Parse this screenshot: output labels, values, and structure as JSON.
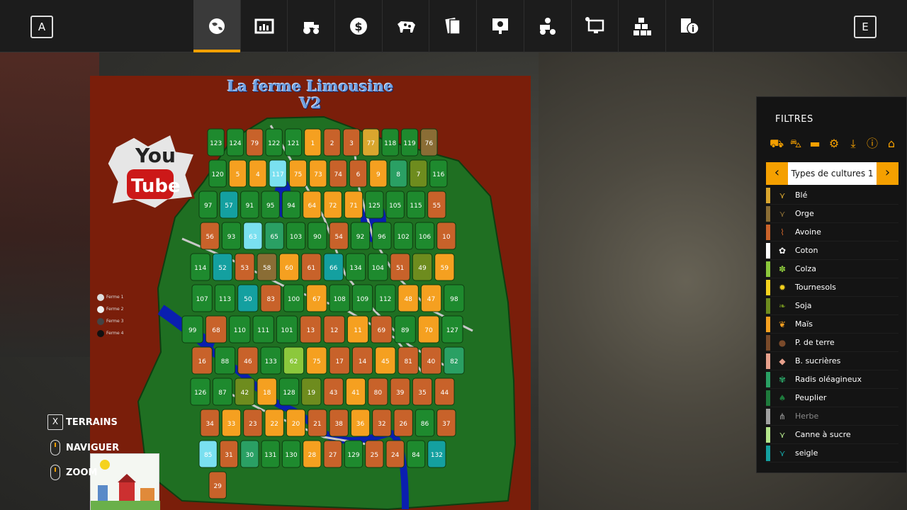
{
  "keys": {
    "left": "A",
    "right": "E"
  },
  "tabs": [
    {
      "name": "map-tab",
      "icon": "globe-icon",
      "active": true
    },
    {
      "name": "stats-tab",
      "icon": "chart-icon",
      "active": false
    },
    {
      "name": "vehicles-tab",
      "icon": "tractor-icon",
      "active": false
    },
    {
      "name": "finances-tab",
      "icon": "dollar-icon",
      "active": false
    },
    {
      "name": "animals-tab",
      "icon": "cow-icon",
      "active": false
    },
    {
      "name": "contracts-tab",
      "icon": "cards-icon",
      "active": false
    },
    {
      "name": "help-tab",
      "icon": "screen-help-icon",
      "active": false
    },
    {
      "name": "prices-tab",
      "icon": "tractor-gear-icon",
      "active": false
    },
    {
      "name": "settings-tab",
      "icon": "monitor-icon",
      "active": false
    },
    {
      "name": "production-tab",
      "icon": "blocks-icon",
      "active": false
    },
    {
      "name": "info-tab",
      "icon": "info-icon",
      "active": false
    }
  ],
  "map": {
    "title_line1": "La ferme Limousine",
    "title_line2": "V2",
    "logo_top": "You",
    "logo_bottom": "Tube",
    "legend": [
      {
        "label": "Ferme 1",
        "color": "#dddddd"
      },
      {
        "label": "Ferme 2",
        "color": "#f0f0f0"
      },
      {
        "label": "Ferme 3",
        "color": "#444444"
      },
      {
        "label": "Ferme 4",
        "color": "#111111"
      }
    ]
  },
  "controls": [
    {
      "key": "X",
      "label": "TERRAINS"
    },
    {
      "key": "mouse",
      "label": "NAVIGUER"
    },
    {
      "key": "mouse",
      "label": "ZOOM"
    }
  ],
  "panel": {
    "title": "FILTRES",
    "filter_icons": [
      "tractor-icon",
      "harvester-icon",
      "trailer-icon",
      "gears-icon",
      "download-icon",
      "warning-icon",
      "home-icon"
    ],
    "selector_label": "Types de cultures 1",
    "crops": [
      {
        "name": "Blé",
        "color": "#d9a62e",
        "icon": "wheat-icon",
        "dim": false
      },
      {
        "name": "Orge",
        "color": "#8a6d35",
        "icon": "barley-icon",
        "dim": false
      },
      {
        "name": "Avoine",
        "color": "#c9622a",
        "icon": "oat-icon",
        "dim": false
      },
      {
        "name": "Coton",
        "color": "#ffffff",
        "icon": "cotton-icon",
        "dim": false
      },
      {
        "name": "Colza",
        "color": "#8cc83c",
        "icon": "canola-icon",
        "dim": false
      },
      {
        "name": "Tournesols",
        "color": "#f5d21e",
        "icon": "sunflower-icon",
        "dim": false
      },
      {
        "name": "Soja",
        "color": "#6e8c1e",
        "icon": "soy-icon",
        "dim": false
      },
      {
        "name": "Maïs",
        "color": "#f5a020",
        "icon": "corn-icon",
        "dim": false
      },
      {
        "name": "P. de terre",
        "color": "#7a4a2a",
        "icon": "potato-icon",
        "dim": false
      },
      {
        "name": "B. sucrières",
        "color": "#e6a08c",
        "icon": "beet-icon",
        "dim": false
      },
      {
        "name": "Radis oléagineux",
        "color": "#2aa064",
        "icon": "radish-icon",
        "dim": false
      },
      {
        "name": "Peuplier",
        "color": "#1e7a3c",
        "icon": "poplar-icon",
        "dim": false
      },
      {
        "name": "Herbe",
        "color": "#a0a0a0",
        "icon": "grass-icon",
        "dim": true
      },
      {
        "name": "Canne à sucre",
        "color": "#b4e68c",
        "icon": "sugarcane-icon",
        "dim": false
      },
      {
        "name": "seigle",
        "color": "#14a0a0",
        "icon": "rye-icon",
        "dim": false
      }
    ]
  },
  "fields": [
    {
      "n": "123",
      "c": "#1e8a2e"
    },
    {
      "n": "124",
      "c": "#1e8a2e"
    },
    {
      "n": "79",
      "c": "#c8622a"
    },
    {
      "n": "122",
      "c": "#1e8a2e"
    },
    {
      "n": "121",
      "c": "#1e8a2e"
    },
    {
      "n": "1",
      "c": "#f5a020"
    },
    {
      "n": "2",
      "c": "#c8622a"
    },
    {
      "n": "3",
      "c": "#c8622a"
    },
    {
      "n": "77",
      "c": "#d9a62e"
    },
    {
      "n": "118",
      "c": "#1e8a2e"
    },
    {
      "n": "119",
      "c": "#1e8a2e"
    },
    {
      "n": "76",
      "c": "#8a6d35"
    },
    {
      "n": "120",
      "c": "#1e8a2e"
    },
    {
      "n": "5",
      "c": "#f5a020"
    },
    {
      "n": "4",
      "c": "#f5a020"
    },
    {
      "n": "117",
      "c": "#7ae0f0"
    },
    {
      "n": "75",
      "c": "#f5a020"
    },
    {
      "n": "73",
      "c": "#f5a020"
    },
    {
      "n": "74",
      "c": "#c8622a"
    },
    {
      "n": "6",
      "c": "#c8622a"
    },
    {
      "n": "9",
      "c": "#f5a020"
    },
    {
      "n": "8",
      "c": "#2aa064"
    },
    {
      "n": "7",
      "c": "#6e8c1e"
    },
    {
      "n": "116",
      "c": "#1e8a2e"
    },
    {
      "n": "97",
      "c": "#1e8a2e"
    },
    {
      "n": "57",
      "c": "#14a0a0"
    },
    {
      "n": "91",
      "c": "#1e8a2e"
    },
    {
      "n": "95",
      "c": "#1e8a2e"
    },
    {
      "n": "94",
      "c": "#1e8a2e"
    },
    {
      "n": "64",
      "c": "#f5a020"
    },
    {
      "n": "72",
      "c": "#f5a020"
    },
    {
      "n": "71",
      "c": "#f5a020"
    },
    {
      "n": "125",
      "c": "#1e8a2e"
    },
    {
      "n": "105",
      "c": "#1e8a2e"
    },
    {
      "n": "115",
      "c": "#1e8a2e"
    },
    {
      "n": "55",
      "c": "#c8622a"
    },
    {
      "n": "56",
      "c": "#c8622a"
    },
    {
      "n": "93",
      "c": "#1e8a2e"
    },
    {
      "n": "63",
      "c": "#7ae0f0"
    },
    {
      "n": "65",
      "c": "#2aa064"
    },
    {
      "n": "103",
      "c": "#1e8a2e"
    },
    {
      "n": "90",
      "c": "#1e8a2e"
    },
    {
      "n": "54",
      "c": "#c8622a"
    },
    {
      "n": "92",
      "c": "#1e8a2e"
    },
    {
      "n": "96",
      "c": "#1e8a2e"
    },
    {
      "n": "102",
      "c": "#1e8a2e"
    },
    {
      "n": "106",
      "c": "#1e8a2e"
    },
    {
      "n": "10",
      "c": "#c8622a"
    },
    {
      "n": "114",
      "c": "#1e8a2e"
    },
    {
      "n": "52",
      "c": "#14a0a0"
    },
    {
      "n": "53",
      "c": "#c8622a"
    },
    {
      "n": "58",
      "c": "#8a6d35"
    },
    {
      "n": "60",
      "c": "#f5a020"
    },
    {
      "n": "61",
      "c": "#c8622a"
    },
    {
      "n": "66",
      "c": "#14a0a0"
    },
    {
      "n": "134",
      "c": "#1e8a2e"
    },
    {
      "n": "104",
      "c": "#1e8a2e"
    },
    {
      "n": "51",
      "c": "#c8622a"
    },
    {
      "n": "49",
      "c": "#6e8c1e"
    },
    {
      "n": "59",
      "c": "#f5a020"
    },
    {
      "n": "107",
      "c": "#1e8a2e"
    },
    {
      "n": "113",
      "c": "#1e8a2e"
    },
    {
      "n": "50",
      "c": "#14a0a0"
    },
    {
      "n": "83",
      "c": "#c8622a"
    },
    {
      "n": "100",
      "c": "#1e8a2e"
    },
    {
      "n": "67",
      "c": "#f5a020"
    },
    {
      "n": "108",
      "c": "#1e8a2e"
    },
    {
      "n": "109",
      "c": "#1e8a2e"
    },
    {
      "n": "112",
      "c": "#1e8a2e"
    },
    {
      "n": "48",
      "c": "#f5a020"
    },
    {
      "n": "47",
      "c": "#f5a020"
    },
    {
      "n": "98",
      "c": "#1e8a2e"
    },
    {
      "n": "99",
      "c": "#1e8a2e"
    },
    {
      "n": "68",
      "c": "#c8622a"
    },
    {
      "n": "110",
      "c": "#1e8a2e"
    },
    {
      "n": "111",
      "c": "#1e8a2e"
    },
    {
      "n": "101",
      "c": "#1e8a2e"
    },
    {
      "n": "13",
      "c": "#c8622a"
    },
    {
      "n": "12",
      "c": "#c8622a"
    },
    {
      "n": "11",
      "c": "#f5a020"
    },
    {
      "n": "69",
      "c": "#c8622a"
    },
    {
      "n": "89",
      "c": "#1e8a2e"
    },
    {
      "n": "70",
      "c": "#f5a020"
    },
    {
      "n": "127",
      "c": "#1e8a2e"
    },
    {
      "n": "16",
      "c": "#c8622a"
    },
    {
      "n": "88",
      "c": "#1e8a2e"
    },
    {
      "n": "46",
      "c": "#c8622a"
    },
    {
      "n": "133",
      "c": "#1e8a2e"
    },
    {
      "n": "62",
      "c": "#8cc83c"
    },
    {
      "n": "75",
      "c": "#f5a020"
    },
    {
      "n": "17",
      "c": "#c8622a"
    },
    {
      "n": "14",
      "c": "#c8622a"
    },
    {
      "n": "45",
      "c": "#f5a020"
    },
    {
      "n": "81",
      "c": "#c8622a"
    },
    {
      "n": "40",
      "c": "#c8622a"
    },
    {
      "n": "82",
      "c": "#2aa064"
    },
    {
      "n": "126",
      "c": "#1e8a2e"
    },
    {
      "n": "87",
      "c": "#1e8a2e"
    },
    {
      "n": "42",
      "c": "#6e8c1e"
    },
    {
      "n": "18",
      "c": "#f5a020"
    },
    {
      "n": "128",
      "c": "#1e8a2e"
    },
    {
      "n": "19",
      "c": "#6e8c1e"
    },
    {
      "n": "43",
      "c": "#c8622a"
    },
    {
      "n": "41",
      "c": "#f5a020"
    },
    {
      "n": "80",
      "c": "#c8622a"
    },
    {
      "n": "39",
      "c": "#c8622a"
    },
    {
      "n": "35",
      "c": "#c8622a"
    },
    {
      "n": "44",
      "c": "#c8622a"
    },
    {
      "n": "34",
      "c": "#c8622a"
    },
    {
      "n": "33",
      "c": "#f5a020"
    },
    {
      "n": "23",
      "c": "#c8622a"
    },
    {
      "n": "22",
      "c": "#f5a020"
    },
    {
      "n": "20",
      "c": "#f5a020"
    },
    {
      "n": "21",
      "c": "#c8622a"
    },
    {
      "n": "38",
      "c": "#c8622a"
    },
    {
      "n": "36",
      "c": "#f5a020"
    },
    {
      "n": "32",
      "c": "#c8622a"
    },
    {
      "n": "26",
      "c": "#c8622a"
    },
    {
      "n": "86",
      "c": "#1e8a2e"
    },
    {
      "n": "37",
      "c": "#c8622a"
    },
    {
      "n": "85",
      "c": "#7ae0f0"
    },
    {
      "n": "31",
      "c": "#c8622a"
    },
    {
      "n": "30",
      "c": "#2aa064"
    },
    {
      "n": "131",
      "c": "#1e8a2e"
    },
    {
      "n": "130",
      "c": "#1e8a2e"
    },
    {
      "n": "28",
      "c": "#f5a020"
    },
    {
      "n": "27",
      "c": "#c8622a"
    },
    {
      "n": "129",
      "c": "#1e8a2e"
    },
    {
      "n": "25",
      "c": "#c8622a"
    },
    {
      "n": "24",
      "c": "#c8622a"
    },
    {
      "n": "84",
      "c": "#1e8a2e"
    },
    {
      "n": "132",
      "c": "#14a0a0"
    },
    {
      "n": "29",
      "c": "#c8622a"
    }
  ]
}
